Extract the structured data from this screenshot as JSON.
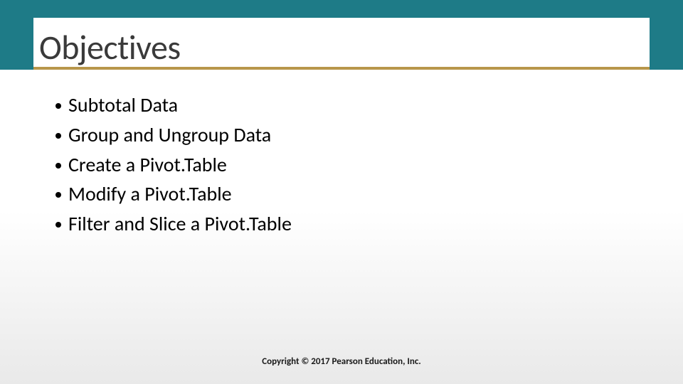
{
  "title": "Objectives",
  "bullets": [
    "Subtotal Data",
    "Group and Ungroup Data",
    "Create a Pivot.Table",
    "Modify a Pivot.Table",
    "Filter and Slice a Pivot.Table"
  ],
  "copyright": "Copyright © 2017 Pearson Education, Inc.",
  "colors": {
    "header_band": "#1e7b87",
    "underline": "#b8964a"
  }
}
